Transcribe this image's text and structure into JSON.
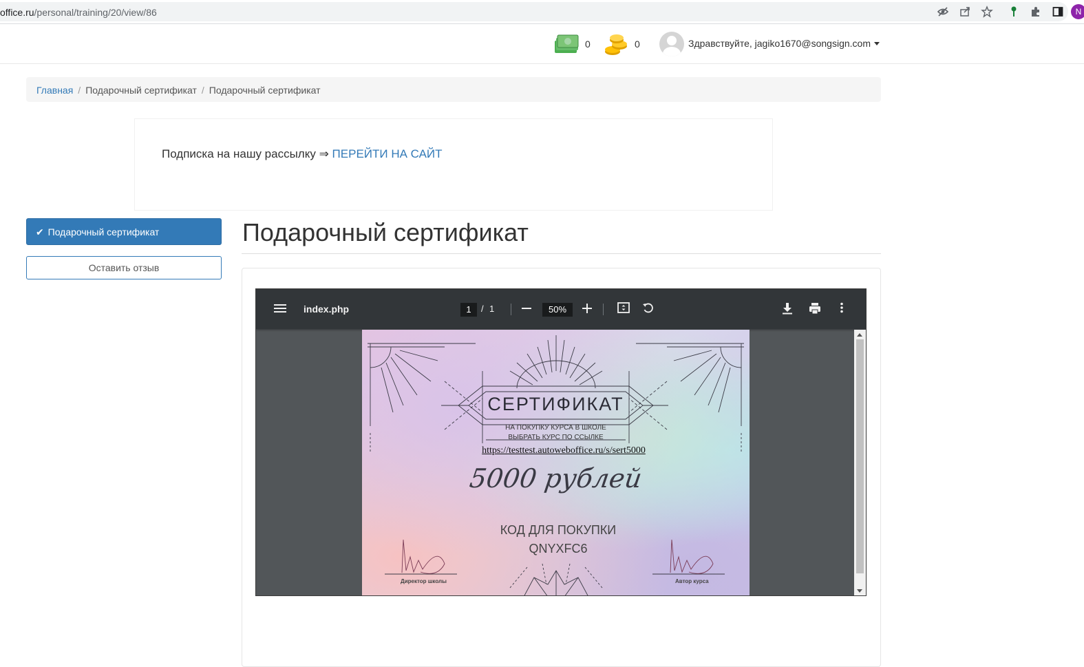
{
  "browser": {
    "url_domain": "office.ru",
    "url_path": "/personal/training/20/view/86",
    "profile_initial": "N"
  },
  "header": {
    "money_balance": "0",
    "coins_balance": "0",
    "greeting": "Здравствуйте, jagiko1670@songsign.com"
  },
  "breadcrumb": {
    "home": "Главная",
    "level1": "Подарочный сертификат",
    "current": "Подарочный сертификат",
    "separator": "/"
  },
  "subscription": {
    "text": "Подписка на нашу рассылку ⇒ ",
    "link": "ПЕРЕЙТИ НА САЙТ"
  },
  "sidebar": {
    "active_item": "Подарочный сертификат",
    "review_button": "Оставить отзыв"
  },
  "main": {
    "title": "Подарочный сертификат"
  },
  "pdf_viewer": {
    "filename": "index.php",
    "current_page": "1",
    "page_separator": "/",
    "total_pages": "1",
    "zoom": "50%"
  },
  "certificate": {
    "title": "СЕРТИФИКАТ",
    "subtitle_line1": "НА ПОКУПКУ КУРСА В ШКОЛЕ",
    "subtitle_line2": "ВЫБРАТЬ КУРС ПО ССЫЛКЕ",
    "link": "https://testtest.autoweboffice.ru/s/sert5000",
    "amount": "5000 рублей",
    "code_label": "КОД ДЛЯ ПОКУПКИ",
    "code": "QNYXFC6",
    "signature_left": "Директор школы",
    "signature_right": "Автор курса"
  },
  "colors": {
    "primary": "#337ab7",
    "pdf_toolbar": "#323639",
    "pdf_background": "#525659"
  }
}
